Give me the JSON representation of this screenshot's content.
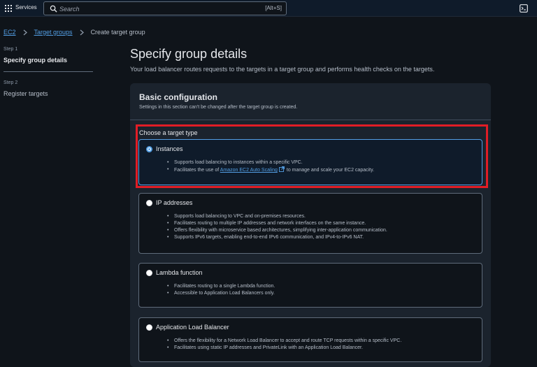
{
  "topnav": {
    "services_label": "Services",
    "search_placeholder": "Search",
    "search_shortcut": "[Alt+S]"
  },
  "breadcrumb": {
    "items": [
      "EC2",
      "Target groups"
    ],
    "current": "Create target group"
  },
  "steps": [
    {
      "label": "Step 1",
      "title": "Specify group details",
      "active": true
    },
    {
      "label": "Step 2",
      "title": "Register targets",
      "active": false
    }
  ],
  "page": {
    "title": "Specify group details",
    "description": "Your load balancer routes requests to the targets in a target group and performs health checks on the targets."
  },
  "basic_config": {
    "title": "Basic configuration",
    "description": "Settings in this section can't be changed after the target group is created.",
    "target_type_label": "Choose a target type",
    "options": [
      {
        "title": "Instances",
        "selected": true,
        "bullets": [
          "Supports load balancing to instances within a specific VPC.",
          "Facilitates the use of"
        ],
        "link_text": "Amazon EC2 Auto Scaling",
        "link_suffix": "to manage and scale your EC2 capacity."
      },
      {
        "title": "IP addresses",
        "selected": false,
        "bullets": [
          "Supports load balancing to VPC and on-premises resources.",
          "Facilitates routing to multiple IP addresses and network interfaces on the same instance.",
          "Offers flexibility with microservice based architectures, simplifying inter-application communication.",
          "Supports IPv6 targets, enabling end-to-end IPv6 communication, and IPv4-to-IPv6 NAT."
        ]
      },
      {
        "title": "Lambda function",
        "selected": false,
        "bullets": [
          "Facilitates routing to a single Lambda function.",
          "Accessible to Application Load Balancers only."
        ]
      },
      {
        "title": "Application Load Balancer",
        "selected": false,
        "bullets": [
          "Offers the flexibility for a Network Load Balancer to accept and route TCP requests within a specific VPC.",
          "Facilitates using static IP addresses and PrivateLink with an Application Load Balancer."
        ]
      }
    ]
  },
  "colors": {
    "accent": "#539fe5",
    "highlight": "#e11d26",
    "background": "#0f141a",
    "panel": "#1b232d"
  },
  "icons": [
    "grid-icon",
    "search-icon",
    "terminal-icon",
    "chevron-right-icon",
    "external-link-icon"
  ]
}
